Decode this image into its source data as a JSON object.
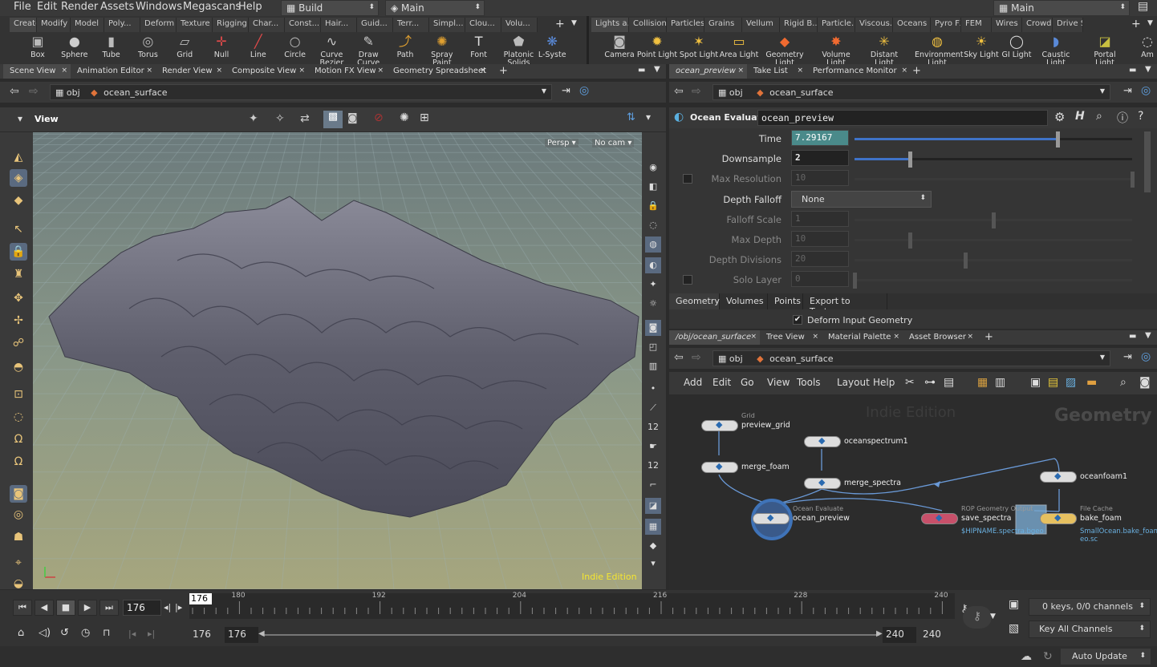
{
  "menubar": {
    "items": [
      "File",
      "Edit",
      "Render",
      "Assets",
      "Windows",
      "Megascans",
      "Help"
    ],
    "desktop": "Build",
    "network": "Main",
    "right_desktop": "Main"
  },
  "shelf_left": {
    "tabs": [
      "Create",
      "Modify",
      "Model",
      "Poly...",
      "Deform",
      "Texture",
      "Rigging",
      "Char...",
      "Const...",
      "Hair...",
      "Guid...",
      "Terr...",
      "Simpl...",
      "Clou...",
      "Volu..."
    ],
    "tools": [
      {
        "label": "Box",
        "icon": "box-icon"
      },
      {
        "label": "Sphere",
        "icon": "sphere-icon"
      },
      {
        "label": "Tube",
        "icon": "tube-icon"
      },
      {
        "label": "Torus",
        "icon": "torus-icon"
      },
      {
        "label": "Grid",
        "icon": "grid-icon"
      },
      {
        "label": "Null",
        "icon": "null-icon"
      },
      {
        "label": "Line",
        "icon": "line-icon"
      },
      {
        "label": "Circle",
        "icon": "circle-icon"
      },
      {
        "label": "Curve Bezier",
        "icon": "curve-bezier-icon"
      },
      {
        "label": "Draw Curve",
        "icon": "draw-curve-icon"
      },
      {
        "label": "Path",
        "icon": "path-icon"
      },
      {
        "label": "Spray Paint",
        "icon": "spray-paint-icon"
      },
      {
        "label": "Font",
        "icon": "font-icon"
      },
      {
        "label": "Platonic Solids",
        "icon": "platonic-solids-icon"
      },
      {
        "label": "L-Syste",
        "icon": "l-system-icon"
      }
    ]
  },
  "shelf_right": {
    "tabs": [
      "Lights a...",
      "Collisions",
      "Particles",
      "Grains",
      "Vellum",
      "Rigid B...",
      "Particle...",
      "Viscous...",
      "Oceans",
      "Pyro FX",
      "FEM",
      "Wires",
      "Crowds",
      "Drive Si..."
    ],
    "tools": [
      {
        "label": "Camera",
        "icon": "camera-icon"
      },
      {
        "label": "Point Light",
        "icon": "point-light-icon"
      },
      {
        "label": "Spot Light",
        "icon": "spot-light-icon"
      },
      {
        "label": "Area Light",
        "icon": "area-light-icon"
      },
      {
        "label": "Geometry Light",
        "icon": "geometry-light-icon"
      },
      {
        "label": "Volume Light",
        "icon": "volume-light-icon"
      },
      {
        "label": "Distant Light",
        "icon": "distant-light-icon"
      },
      {
        "label": "Environment Light",
        "icon": "environment-light-icon"
      },
      {
        "label": "Sky Light",
        "icon": "sky-light-icon"
      },
      {
        "label": "GI Light",
        "icon": "gi-light-icon"
      },
      {
        "label": "Caustic Light",
        "icon": "caustic-light-icon"
      },
      {
        "label": "Portal Light",
        "icon": "portal-light-icon"
      },
      {
        "label": "Am",
        "icon": "ambient-light-icon"
      }
    ]
  },
  "left_pane": {
    "tabs": [
      "Scene View",
      "Animation Editor",
      "Render View",
      "Composite View",
      "Motion FX View",
      "Geometry Spreadsheet"
    ],
    "path_obj": "obj",
    "path_node": "ocean_surface",
    "view_label": "View",
    "persp_label": "Persp",
    "cam_label": "No cam",
    "indie_label": "Indie Edition"
  },
  "param_pane": {
    "tabs": [
      "ocean_preview",
      "Take List",
      "Performance Monitor"
    ],
    "path_obj": "obj",
    "path_node": "ocean_surface",
    "node_type": "Ocean Evaluate",
    "node_name": "ocean_preview",
    "params": [
      {
        "label": "Time",
        "value": "7.29167",
        "fraction": 0.73,
        "enabled": true,
        "checkbox": false
      },
      {
        "label": "Downsample",
        "value": "2",
        "fraction": 0.2,
        "enabled": true,
        "checkbox": false
      },
      {
        "label": "Max Resolution",
        "value": "10",
        "fraction": 1.0,
        "enabled": false,
        "checkbox": true
      },
      {
        "label": "Depth Falloff",
        "value": "None",
        "type": "menu",
        "enabled": true,
        "checkbox": false
      },
      {
        "label": "Falloff Scale",
        "value": "1",
        "fraction": 0.5,
        "enabled": false,
        "checkbox": false
      },
      {
        "label": "Max Depth",
        "value": "10",
        "fraction": 0.2,
        "enabled": false,
        "checkbox": false
      },
      {
        "label": "Depth Divisions",
        "value": "20",
        "fraction": 0.4,
        "enabled": false,
        "checkbox": false
      },
      {
        "label": "Solo Layer",
        "value": "0",
        "fraction": 0.0,
        "enabled": false,
        "checkbox": true
      }
    ],
    "subtabs": [
      "Geometry",
      "Volumes",
      "Points",
      "Export to Texture"
    ],
    "deform_label": "Deform Input Geometry"
  },
  "network_pane": {
    "tabs": [
      "/obj/ocean_surface",
      "Tree View",
      "Material Palette",
      "Asset Browser"
    ],
    "path_obj": "obj",
    "path_node": "ocean_surface",
    "menu": [
      "Add",
      "Edit",
      "Go",
      "View",
      "Tools",
      "Layout",
      "Help"
    ],
    "watermark": "Indie Edition",
    "context_label": "Geometry",
    "nodes": [
      {
        "name": "preview_grid",
        "type": "Grid"
      },
      {
        "name": "merge_foam",
        "type": ""
      },
      {
        "name": "oceanspectrum1",
        "type": ""
      },
      {
        "name": "merge_spectra",
        "type": ""
      },
      {
        "name": "oceanfoam1",
        "type": ""
      },
      {
        "name": "ocean_preview",
        "type": "Ocean Evaluate"
      },
      {
        "name": "save_spectra",
        "type": "ROP Geometry Output",
        "extra": "$HIPNAME.spectra.bgeo"
      },
      {
        "name": "bake_foam",
        "type": "File Cache",
        "extra": "SmallOcean.bake_foam_v\neo.sc"
      }
    ]
  },
  "timeline": {
    "current_frame": "176",
    "ticks": [
      "180",
      "192",
      "204",
      "216",
      "228",
      "240"
    ],
    "marker": "176",
    "range_start": "176",
    "range_start2": "176",
    "range_end": "240",
    "range_end2": "240",
    "keys_label": "0 keys, 0/0 channels",
    "key_all_label": "Key All Channels",
    "auto_update": "Auto Update"
  }
}
